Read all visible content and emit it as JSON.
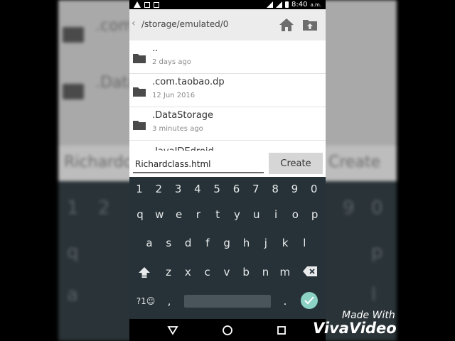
{
  "status_bar": {
    "time": "8:40",
    "ampm": "a.m."
  },
  "header": {
    "back_icon": "chevron-left-icon",
    "path": "/storage/emulated/0",
    "home_icon": "home-icon",
    "new_folder_icon": "new-folder-icon"
  },
  "files": [
    {
      "name": "..",
      "date": "2 days ago",
      "icon": "folder-icon"
    },
    {
      "name": ".com.taobao.dp",
      "date": "12 Jun 2016",
      "icon": "folder-icon"
    },
    {
      "name": ".DataStorage",
      "date": "3 minutes ago",
      "icon": "folder-icon"
    },
    {
      "name": ".JavaIDEdroid",
      "date": "",
      "icon": "folder-icon"
    }
  ],
  "input": {
    "value": "Richardclass.html"
  },
  "create_label": "Create",
  "keyboard": {
    "numbers": [
      "1",
      "2",
      "3",
      "4",
      "5",
      "6",
      "7",
      "8",
      "9",
      "0"
    ],
    "row1": [
      "q",
      "w",
      "e",
      "r",
      "t",
      "y",
      "u",
      "i",
      "o",
      "p"
    ],
    "row2": [
      "a",
      "s",
      "d",
      "f",
      "g",
      "h",
      "j",
      "k",
      "l"
    ],
    "row3": [
      "z",
      "x",
      "c",
      "v",
      "b",
      "n",
      "m"
    ],
    "symbols_label": "?1☺",
    "comma": ",",
    "period": ".",
    "shift_icon": "shift-icon",
    "backspace_icon": "backspace-icon",
    "enter_icon": "check-icon"
  },
  "navbar": {
    "back_icon": "back-triangle-icon",
    "home_icon": "home-circle-icon",
    "recents_icon": "recents-square-icon"
  },
  "watermark": {
    "line1": "Made With",
    "line2": "VivaVideo"
  },
  "colors": {
    "keyboard_bg": "#263238",
    "accent": "#8bd1c4",
    "header_bg": "#ececec"
  }
}
